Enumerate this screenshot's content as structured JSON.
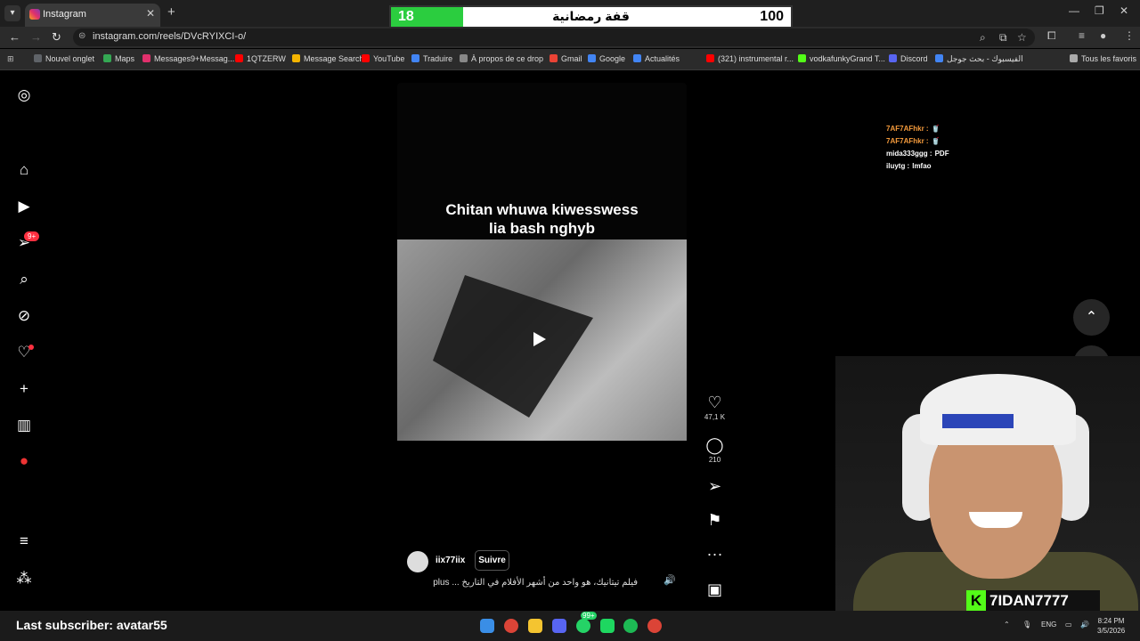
{
  "browser": {
    "tab_title": "Instagram",
    "url": "instagram.com/reels/DVcRYIXCI-o/",
    "new_tab_symbol": "+",
    "bookmarks": [
      {
        "label": "Nouvel onglet",
        "color": "#5f6368"
      },
      {
        "label": "Maps",
        "color": "#34a853"
      },
      {
        "label": "Messages9+Messag...",
        "color": "#e1306c"
      },
      {
        "label": "1QTZERW",
        "color": "#ff0000"
      },
      {
        "label": "Message Search",
        "color": "#f4b400"
      },
      {
        "label": "YouTube",
        "color": "#ff0000"
      },
      {
        "label": "Traduire",
        "color": "#4285f4"
      },
      {
        "label": "À propos de ce drop",
        "color": "#888888"
      },
      {
        "label": "Gmail",
        "color": "#ea4335"
      },
      {
        "label": "Google",
        "color": "#4285f4"
      },
      {
        "label": "Actualités",
        "color": "#4285f4"
      },
      {
        "label": "(321) instrumental r...",
        "color": "#ff0000"
      },
      {
        "label": "vodkafunkyGrand T...",
        "color": "#53fc18"
      },
      {
        "label": "Discord",
        "color": "#5865f2"
      },
      {
        "label": "الفيسبوك - بحث جوجل",
        "color": "#4285f4"
      },
      {
        "label": "Tous les favoris",
        "color": "#aaaaaa"
      }
    ]
  },
  "goal_overlay": {
    "current": "18",
    "title": "قفة رمضانية",
    "target": "100",
    "progress_fraction": 0.18,
    "fill_color": "#2bcd3f"
  },
  "sidebar": {
    "notifications_badge": "9+"
  },
  "reel": {
    "caption_line1": "Chitan whuwa kiwesswess",
    "caption_line2": "lia bash nghyb",
    "username": "iix77iix",
    "follow_label": "Suivre",
    "description": "فيلم تيتانيك، هو واحد من أشهر الأفلام في التاريخ ... plus",
    "likes": "47,1 K",
    "comments": "210",
    "more_symbol": "···"
  },
  "chat": [
    {
      "user": "7AF7AFhkr :",
      "msg": "🥤"
    },
    {
      "user": "7AF7AFhkr :",
      "msg": "🥤"
    },
    {
      "user": "mida333ggg :",
      "msg": "PDF"
    },
    {
      "user": "iluytg :",
      "msg": "lmfao"
    }
  ],
  "stream": {
    "last_subscriber": "Last subscriber: avatar55",
    "streamer_name": "7IDAN7777",
    "streamer_logo": "K"
  },
  "taskbar": {
    "language": "ENG",
    "time": "8:24 PM",
    "date": "3/5/2026",
    "badge": "99+"
  }
}
